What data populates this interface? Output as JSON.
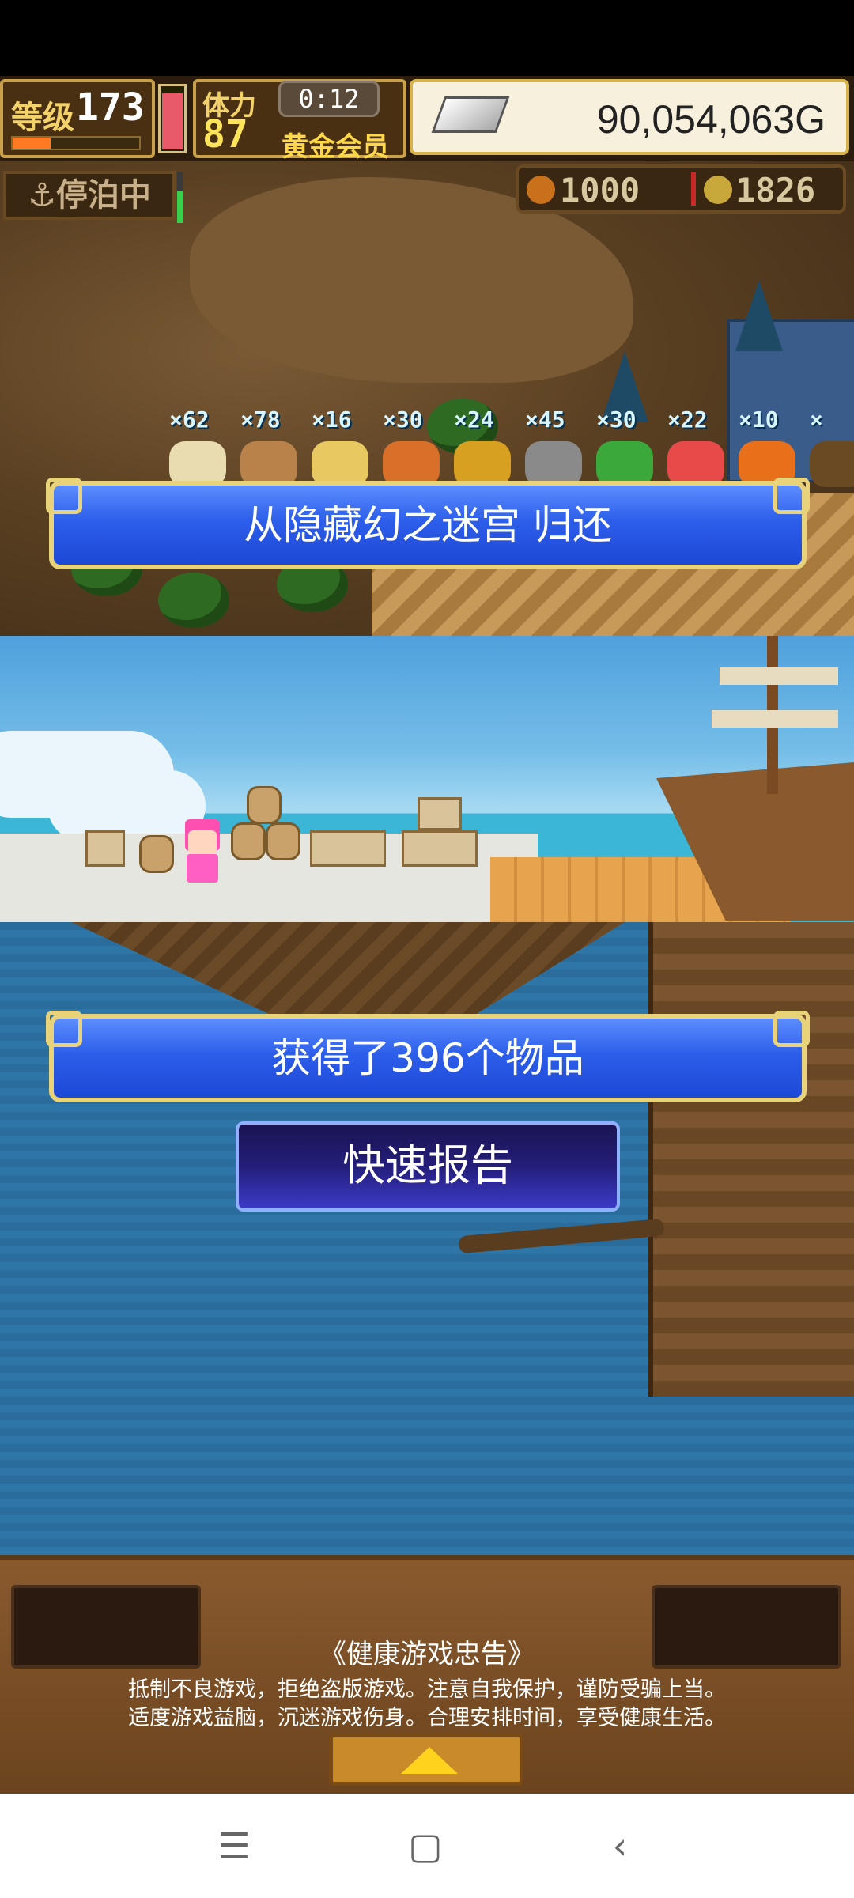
{
  "hud": {
    "level_label": "等级",
    "level": "173",
    "stamina_label": "体力",
    "stamina": "87",
    "timer": "0:12",
    "membership": "黄金会员",
    "money": "90,054,063G"
  },
  "status": {
    "docked_label": "⚓停泊中",
    "resource_a": "1000",
    "resource_b": "1826"
  },
  "items": [
    {
      "count": "×62",
      "icon": "flour-sack-icon",
      "color": "#e8dcb0"
    },
    {
      "count": "×78",
      "icon": "lumber-icon",
      "color": "#b8824a"
    },
    {
      "count": "×16",
      "icon": "potato-icon",
      "color": "#e8c860"
    },
    {
      "count": "×30",
      "icon": "meat-icon",
      "color": "#d8702a"
    },
    {
      "count": "×24",
      "icon": "barrel-icon",
      "color": "#d8a020"
    },
    {
      "count": "×45",
      "icon": "ore-icon",
      "color": "#8a8a8a"
    },
    {
      "count": "×30",
      "icon": "herb-icon",
      "color": "#3aa83a"
    },
    {
      "count": "×22",
      "icon": "potion-icon",
      "color": "#e84a4a"
    },
    {
      "count": "×10",
      "icon": "pumpkin-icon",
      "color": "#e8701a"
    },
    {
      "count": "×",
      "icon": "more-item-icon",
      "color": "#6a4a22"
    }
  ],
  "banners": {
    "return": "从隐藏幻之迷宫  归还",
    "obtained": "获得了396个物品",
    "quick_report": "快速报告"
  },
  "notice": {
    "title": "《健康游戏忠告》",
    "line1": "抵制不良游戏，拒绝盗版游戏。注意自我保护，谨防受骗上当。",
    "line2": "适度游戏益脑，沉迷游戏伤身。合理安排时间，享受健康生活。"
  },
  "nav": {
    "menu": "☰",
    "home": "▢",
    "back": "‹"
  },
  "colors": {
    "banner_blue": "#2c5eea",
    "banner_border": "#e8d27a",
    "money_bg": "#f7f0dc"
  }
}
